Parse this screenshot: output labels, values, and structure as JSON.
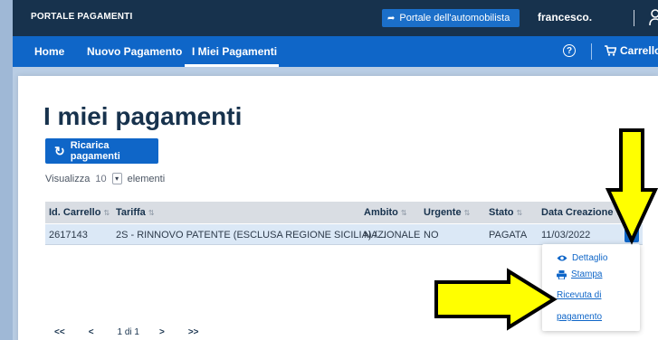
{
  "topbar": {
    "brand": "PORTALE PAGAMENTI",
    "portal_link": "Portale dell'automobilista",
    "user_name": "francesco."
  },
  "nav": {
    "home": "Home",
    "new_payment": "Nuovo Pagamento",
    "my_payments": "I Miei Pagamenti",
    "help_icon": "?",
    "cart_label": "Carrello"
  },
  "page": {
    "title": "I miei pagamenti",
    "reload_button": "Ricarica pagamenti",
    "show_prefix": "Visualizza",
    "show_count": "10",
    "show_suffix": "elementi"
  },
  "table": {
    "columns": [
      "Id. Carrello",
      "Tariffa",
      "Ambito",
      "Urgente",
      "Stato",
      "Data Creazione"
    ],
    "sort_glyph": "⇅",
    "rows": [
      [
        "2617143",
        "2S - RINNOVO PATENTE (ESCLUSA REGIONE SICILIA) /...",
        "NAZIONALE",
        "NO",
        "PAGATA",
        "11/03/2022"
      ]
    ]
  },
  "row_menu": {
    "details": "Dettaglio",
    "print": "Stampa",
    "receipt_line1": "Ricevuta di",
    "receipt_line2": "pagamento"
  },
  "pagination": {
    "first": "<<",
    "prev": "<",
    "info": "1 di 1",
    "next": ">",
    "last": ">>"
  },
  "colors": {
    "topbar": "#17324d",
    "navbar": "#0f66c8",
    "accent": "#0f66c8",
    "annotation_fill": "#ffff00",
    "annotation_stroke": "#000000"
  },
  "icons": {
    "portal": "sign-in-icon",
    "user": "user-icon",
    "help": "question-circle-icon",
    "cart": "cart-icon",
    "reload": "refresh-icon",
    "select": "chevron-down-icon",
    "row_action": "chevron-down-icon",
    "details": "eye-icon",
    "print": "printer-icon"
  }
}
